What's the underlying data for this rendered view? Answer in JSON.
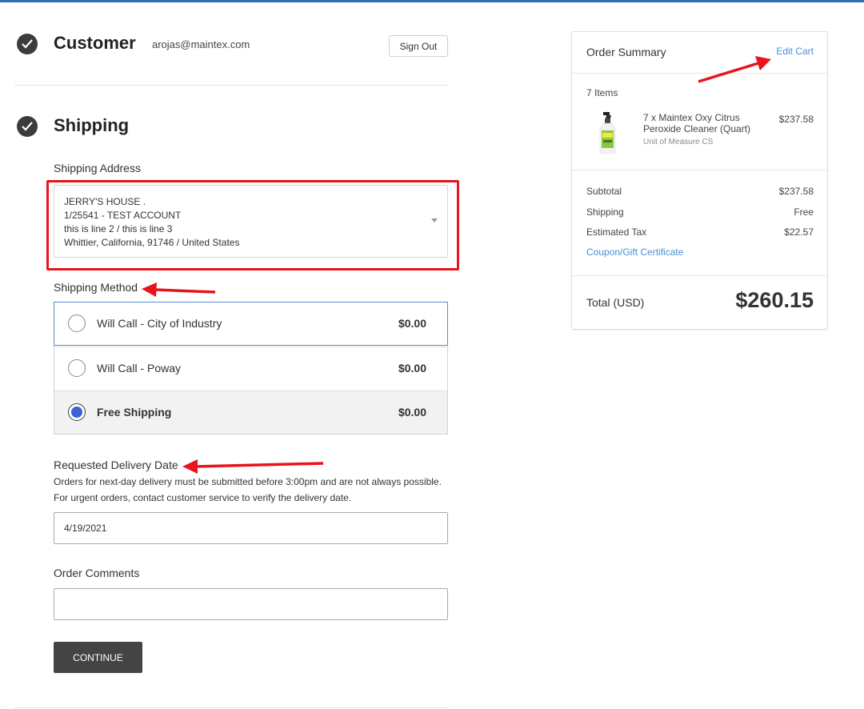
{
  "customer": {
    "title": "Customer",
    "email": "arojas@maintex.com",
    "sign_out_label": "Sign Out"
  },
  "shipping": {
    "title": "Shipping",
    "address_label": "Shipping Address",
    "address_lines": [
      "JERRY'S HOUSE .",
      "1/25541 - TEST ACCOUNT",
      "this is line 2 / this is line 3",
      "Whittier, California, 91746 / United States"
    ],
    "method_label": "Shipping Method",
    "methods": [
      {
        "name": "Will Call - City of Industry",
        "price": "$0.00",
        "selected": false
      },
      {
        "name": "Will Call - Poway",
        "price": "$0.00",
        "selected": false
      },
      {
        "name": "Free Shipping",
        "price": "$0.00",
        "selected": true
      }
    ],
    "delivery_label": "Requested Delivery Date",
    "delivery_help_1": "Orders for next-day delivery must be submitted before 3:00pm and are not always possible.",
    "delivery_help_2": "For urgent orders, contact customer service to verify the delivery date.",
    "delivery_date": "4/19/2021",
    "comments_label": "Order Comments",
    "comments_value": "",
    "continue_label": "CONTINUE"
  },
  "summary": {
    "title": "Order Summary",
    "edit_cart_label": "Edit Cart",
    "items_count": "7 Items",
    "product": {
      "name": "7 x Maintex Oxy Citrus Peroxide Cleaner (Quart)",
      "uom": "Unit of Measure CS",
      "price": "$237.58"
    },
    "subtotal_label": "Subtotal",
    "subtotal_value": "$237.58",
    "shipping_label": "Shipping",
    "shipping_value": "Free",
    "tax_label": "Estimated Tax",
    "tax_value": "$22.57",
    "coupon_label": "Coupon/Gift Certificate",
    "total_label": "Total (USD)",
    "total_value": "$260.15"
  },
  "colors": {
    "accent_blue": "#2f6fb5",
    "link_blue": "#4a90d9",
    "annotation_red": "#e8141c",
    "radio_selected": "#3b63d6"
  }
}
